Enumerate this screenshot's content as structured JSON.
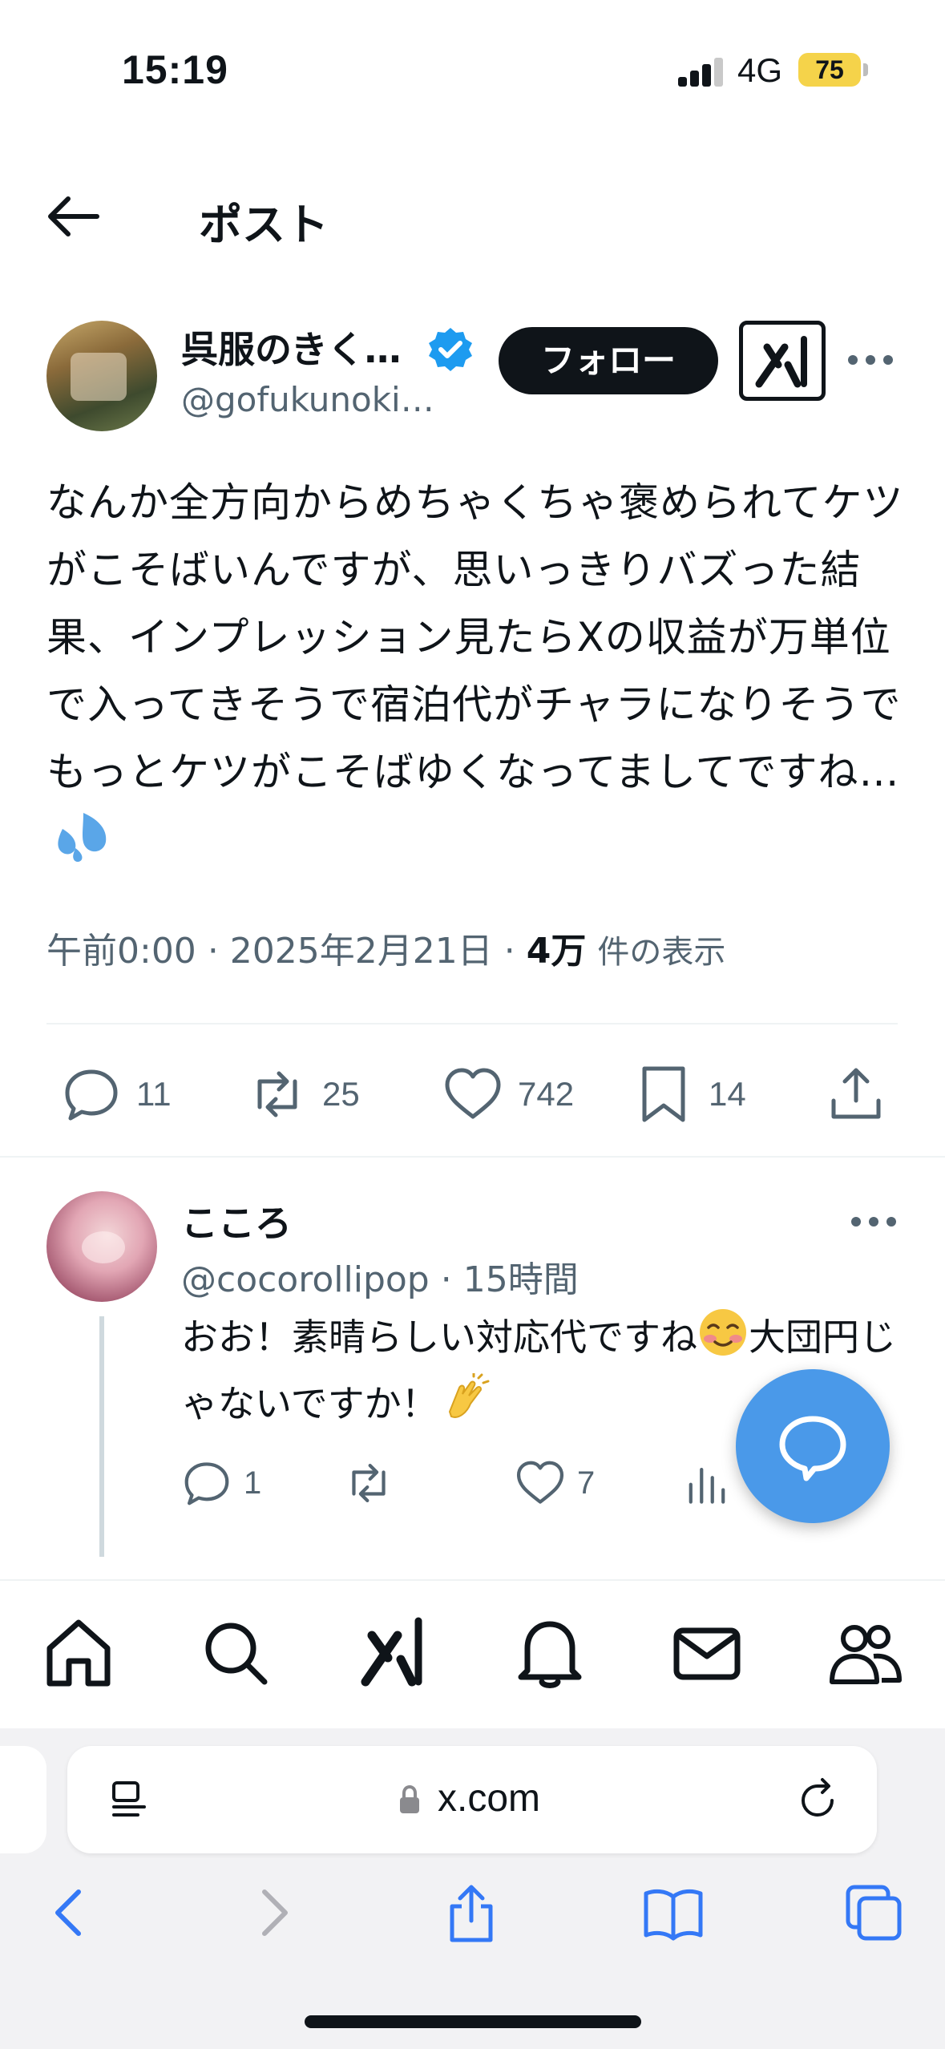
{
  "status_bar": {
    "time": "15:19",
    "network": "4G",
    "battery": "75"
  },
  "header": {
    "title": "ポスト"
  },
  "tweet": {
    "author_name": "呉服のきく…",
    "author_handle": "@gofukunoki…",
    "follow_label": "フォロー",
    "text": "なんか全方向からめちゃくちゃ褒められてケツがこそばいんですが、思いっきりバズった結果、インプレッション見たらXの収益が万単位で入ってきそうで宿泊代がチャラになりそうでもっとケツがこそばゆくなってましてですね…",
    "time": "午前0:00",
    "date": "2025年2月21日",
    "views_count": "4万",
    "views_label": "件の表示",
    "stats": {
      "replies": "11",
      "reposts": "25",
      "likes": "742",
      "bookmarks": "14"
    }
  },
  "reply": {
    "name": "こころ",
    "handle": "@cocorollipop",
    "time": "15時間",
    "text_part1": "おお！素晴らしい対応代ですね",
    "text_part2": "大団円じゃないですか！",
    "stats": {
      "replies": "1",
      "likes": "7"
    }
  },
  "browser": {
    "url": "x.com"
  },
  "colors": {
    "accent": "#1d9bf0",
    "fab": "#4a99e9",
    "text": "#0f1419",
    "secondary": "#536471",
    "battery": "#f5d34a"
  }
}
